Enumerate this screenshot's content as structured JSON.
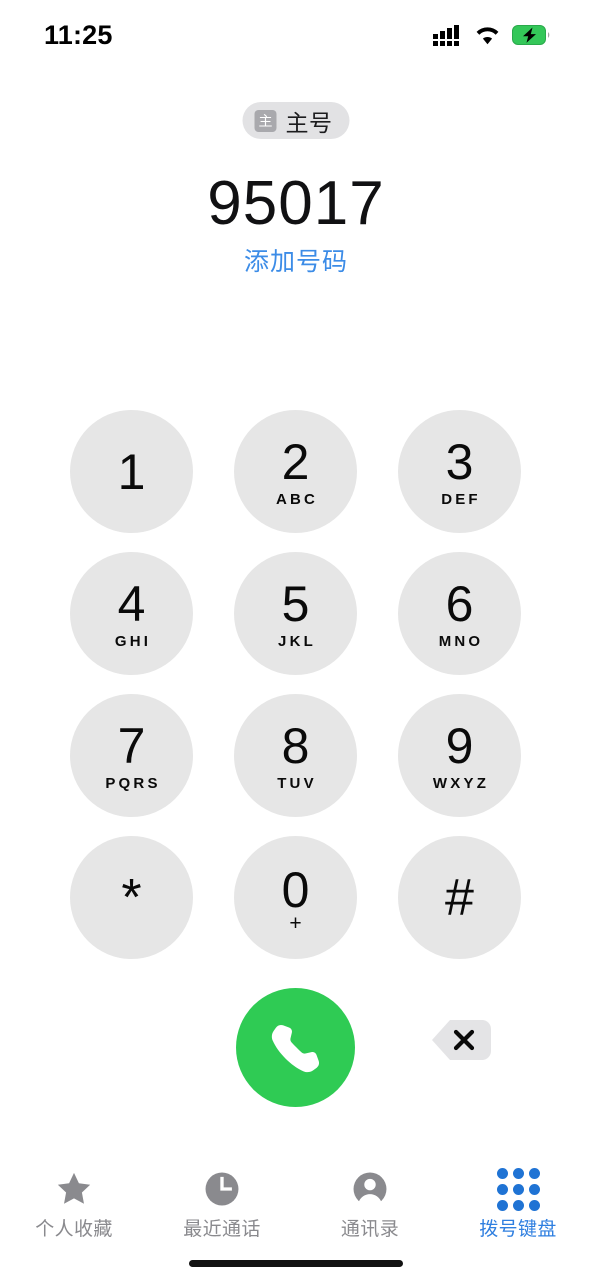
{
  "status_bar": {
    "time": "11:25",
    "signal_icon": "cellular-signal-icon",
    "wifi_icon": "wifi-icon",
    "battery_icon": "battery-charging-icon",
    "battery_charging": true,
    "signal_bars": 4
  },
  "sim_badge": {
    "glyph": "主",
    "label": "主号",
    "icon": "sim-card-icon"
  },
  "dialed_number": "95017",
  "add_number_label": "添加号码",
  "keypad": [
    {
      "digit": "1",
      "letters": ""
    },
    {
      "digit": "2",
      "letters": "ABC"
    },
    {
      "digit": "3",
      "letters": "DEF"
    },
    {
      "digit": "4",
      "letters": "GHI"
    },
    {
      "digit": "5",
      "letters": "JKL"
    },
    {
      "digit": "6",
      "letters": "MNO"
    },
    {
      "digit": "7",
      "letters": "PQRS"
    },
    {
      "digit": "8",
      "letters": "TUV"
    },
    {
      "digit": "9",
      "letters": "WXYZ"
    },
    {
      "digit": "*",
      "letters": ""
    },
    {
      "digit": "0",
      "letters": "+"
    },
    {
      "digit": "#",
      "letters": ""
    }
  ],
  "actions": {
    "call_icon": "phone-handset-icon",
    "delete_icon": "backspace-delete-icon"
  },
  "tabs": [
    {
      "label": "个人收藏",
      "icon": "star-icon",
      "active": false
    },
    {
      "label": "最近通话",
      "icon": "clock-icon",
      "active": false
    },
    {
      "label": "通讯录",
      "icon": "person-circle-icon",
      "active": false
    },
    {
      "label": "拨号键盘",
      "icon": "keypad-grid-icon",
      "active": true
    }
  ],
  "colors": {
    "call_green": "#2fcb54",
    "key_gray": "#e6e6e6",
    "accent_blue": "#3c8ce7",
    "tab_active_blue": "#2f7fe0",
    "tab_inactive_gray": "#8a8a8e",
    "battery_green": "#34c759"
  }
}
